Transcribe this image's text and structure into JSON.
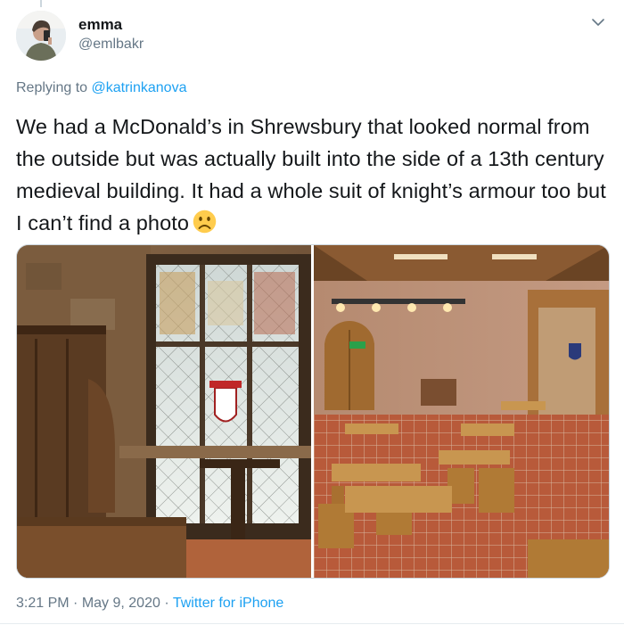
{
  "tweet": {
    "author_name": "emma",
    "author_handle": "@emlbakr",
    "replying_prefix": "Replying to ",
    "replying_to": "@katrinkanova",
    "text": "We had a McDonald’s in Shrewsbury that looked normal from the outside but was actually built into the side of a 13th century medieval building. It had a whole suit of knight’s armour too but I can’t find a photo",
    "emoji": "sad-face-emoji",
    "time": "3:21 PM",
    "separator1": " · ",
    "date": "May 9, 2020",
    "separator2": " · ",
    "source": "Twitter for iPhone"
  },
  "media": {
    "photos": [
      {
        "name": "stained-glass-window-interior"
      },
      {
        "name": "medieval-dining-room-interior"
      }
    ]
  },
  "icons": {
    "caret": "chevron-down-icon",
    "avatar": "avatar"
  },
  "colors": {
    "link": "#1da1f2",
    "muted": "#657786",
    "text": "#14171a"
  }
}
